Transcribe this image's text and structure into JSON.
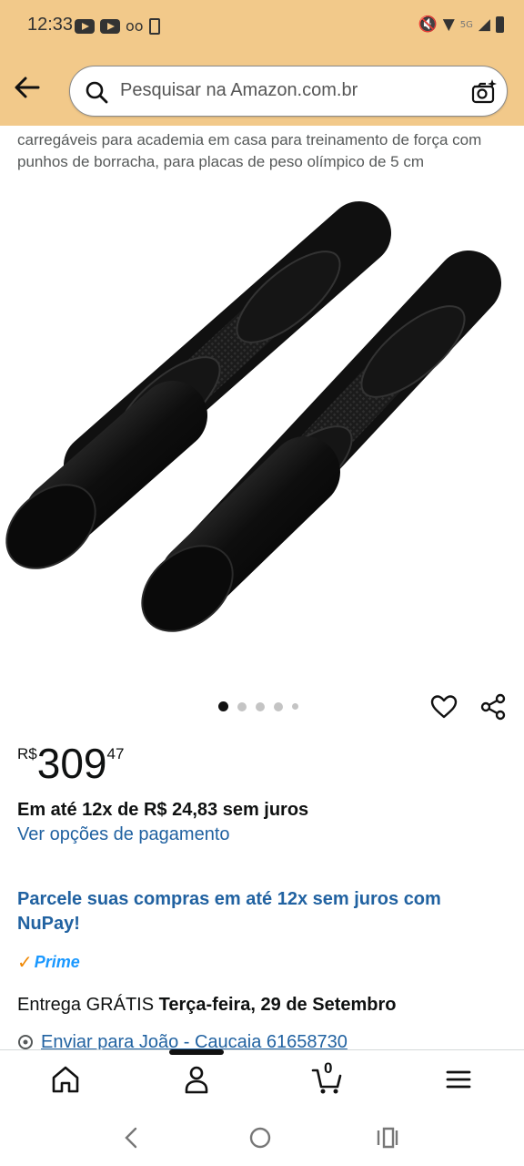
{
  "status_bar": {
    "time": "12:33",
    "signal_text": "5G"
  },
  "search": {
    "placeholder": "Pesquisar na Amazon.com.br"
  },
  "product": {
    "title_visible": "carregáveis para academia em casa para treinamento de força com punhos de borracha, para placas de peso olímpico de 5 cm",
    "image_count": 5,
    "active_image": 1,
    "price_symbol": "R$",
    "price_whole": "309",
    "price_cents": "47",
    "installments": "Em até 12x de R$ 24,83 sem juros",
    "payment_options_link": "Ver opções de pagamento",
    "nupay_promo": "Parcele suas compras em até 12x sem juros com NuPay!",
    "prime_label": "Prime",
    "delivery_prefix": "Entrega GRÁTIS",
    "delivery_date": "Terça-feira, 29 de Setembro",
    "ship_to": "Enviar para João - Caucaia 61658730"
  },
  "bottom_nav": {
    "cart_count": "0",
    "items": [
      "home-icon",
      "account-icon",
      "cart-icon",
      "menu-icon"
    ]
  },
  "colors": {
    "header_bg": "#f2c98a",
    "link": "#2162a1",
    "prime_check": "#f08804",
    "prime_blue": "#1a98ff"
  }
}
